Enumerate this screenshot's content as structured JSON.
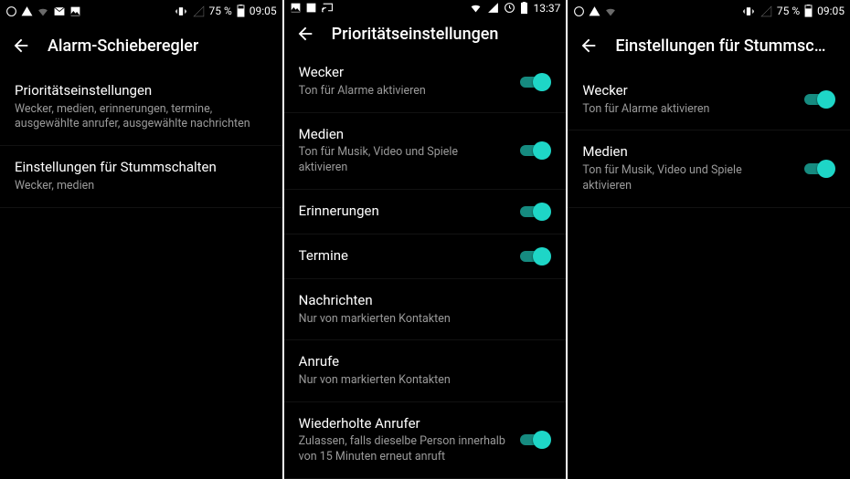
{
  "screens": [
    {
      "status": {
        "battery": "75 %",
        "time": "09:05"
      },
      "title": "Alarm-Schieberegler",
      "rows": [
        {
          "title": "Prioritätseinstellungen",
          "sub": "Wecker, medien, erinnerungen, termine, ausgewählte anrufer, ausgewählte nachrichten",
          "toggle": false
        },
        {
          "title": "Einstellungen für Stummschalten",
          "sub": "Wecker, medien",
          "toggle": false
        }
      ]
    },
    {
      "status": {
        "battery": "",
        "time": "13:37"
      },
      "title": "Prioritätseinstellungen",
      "rows": [
        {
          "title": "Wecker",
          "sub": "Ton für Alarme aktivieren",
          "toggle": true
        },
        {
          "title": "Medien",
          "sub": "Ton für Musik, Video und Spiele aktivieren",
          "toggle": true
        },
        {
          "title": "Erinnerungen",
          "sub": "",
          "toggle": true
        },
        {
          "title": "Termine",
          "sub": "",
          "toggle": true
        },
        {
          "title": "Nachrichten",
          "sub": "Nur von markierten Kontakten",
          "toggle": false
        },
        {
          "title": "Anrufe",
          "sub": "Nur von markierten Kontakten",
          "toggle": false
        },
        {
          "title": "Wiederholte Anrufer",
          "sub": "Zulassen, falls dieselbe Person innerhalb von 15 Minuten erneut anruft",
          "toggle": true
        }
      ]
    },
    {
      "status": {
        "battery": "75 %",
        "time": "09:05"
      },
      "title": "Einstellungen für Stummsc…",
      "rows": [
        {
          "title": "Wecker",
          "sub": "Ton für Alarme aktivieren",
          "toggle": true
        },
        {
          "title": "Medien",
          "sub": "Ton für Musik, Video und Spiele aktivieren",
          "toggle": true
        }
      ]
    }
  ]
}
